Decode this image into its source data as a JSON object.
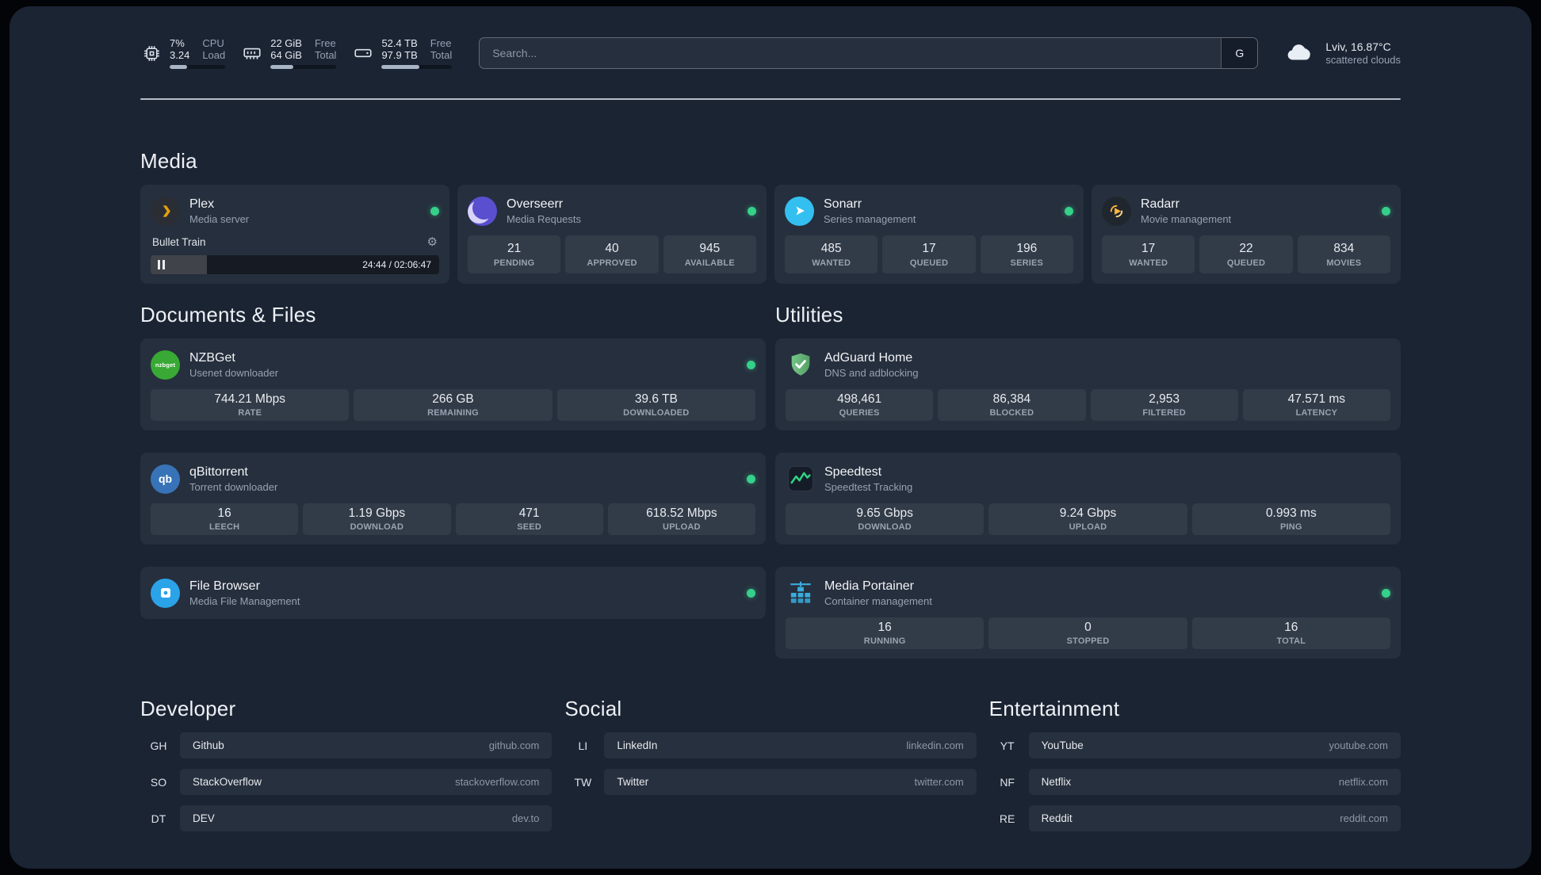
{
  "colors": {
    "background": "#1b2433",
    "card": "rgba(255,255,255,0.05)",
    "tile": "rgba(255,255,255,0.06)",
    "status_online": "#35d08a",
    "plex_gold": "#e5a00d",
    "adguard_green": "#67b47a",
    "speedtest_green": "#2fd180"
  },
  "topbar": {
    "cpu": {
      "icon": "cpu-chip-icon",
      "values": [
        "7%",
        "3.24"
      ],
      "labels": [
        "CPU",
        "Load"
      ],
      "progress_percent": 32
    },
    "memory": {
      "icon": "memory-icon",
      "values": [
        "22 GiB",
        "64 GiB"
      ],
      "labels": [
        "Free",
        "Total"
      ],
      "progress_percent": 35
    },
    "disk": {
      "icon": "disk-icon",
      "values": [
        "52.4 TB",
        "97.9 TB"
      ],
      "labels": [
        "Free",
        "Total"
      ],
      "progress_percent": 54
    },
    "search": {
      "placeholder": "Search...",
      "provider_button": "G"
    },
    "weather": {
      "icon": "cloud-icon",
      "location": "Lviv, 16.87°C",
      "condition": "scattered clouds"
    }
  },
  "sections": {
    "media": {
      "title": "Media",
      "services": {
        "plex": {
          "name": "Plex",
          "subtitle": "Media server",
          "status": "online",
          "player": {
            "track": "Bullet Train",
            "time_display": "24:44 / 02:06:47",
            "progress_percent": 19.5
          }
        },
        "overseerr": {
          "name": "Overseerr",
          "subtitle": "Media Requests",
          "status": "online",
          "stats": [
            {
              "value": "21",
              "label": "PENDING"
            },
            {
              "value": "40",
              "label": "APPROVED"
            },
            {
              "value": "945",
              "label": "AVAILABLE"
            }
          ]
        },
        "sonarr": {
          "name": "Sonarr",
          "subtitle": "Series management",
          "status": "online",
          "stats": [
            {
              "value": "485",
              "label": "WANTED"
            },
            {
              "value": "17",
              "label": "QUEUED"
            },
            {
              "value": "196",
              "label": "SERIES"
            }
          ]
        },
        "radarr": {
          "name": "Radarr",
          "subtitle": "Movie management",
          "status": "online",
          "stats": [
            {
              "value": "17",
              "label": "WANTED"
            },
            {
              "value": "22",
              "label": "QUEUED"
            },
            {
              "value": "834",
              "label": "MOVIES"
            }
          ]
        }
      }
    },
    "documents": {
      "title": "Documents & Files",
      "services": {
        "nzbget": {
          "name": "NZBGet",
          "subtitle": "Usenet downloader",
          "status": "online",
          "icon_text": "nzbget",
          "stats": [
            {
              "value": "744.21 Mbps",
              "label": "RATE"
            },
            {
              "value": "266 GB",
              "label": "REMAINING"
            },
            {
              "value": "39.6 TB",
              "label": "DOWNLOADED"
            }
          ]
        },
        "qbittorrent": {
          "name": "qBittorrent",
          "subtitle": "Torrent downloader",
          "status": "online",
          "icon_text": "qb",
          "stats": [
            {
              "value": "16",
              "label": "LEECH"
            },
            {
              "value": "1.19 Gbps",
              "label": "DOWNLOAD"
            },
            {
              "value": "471",
              "label": "SEED"
            },
            {
              "value": "618.52 Mbps",
              "label": "UPLOAD"
            }
          ]
        },
        "filebrowser": {
          "name": "File Browser",
          "subtitle": "Media File Management",
          "status": "online"
        }
      }
    },
    "utilities": {
      "title": "Utilities",
      "services": {
        "adguard": {
          "name": "AdGuard Home",
          "subtitle": "DNS and adblocking",
          "stats": [
            {
              "value": "498,461",
              "label": "QUERIES"
            },
            {
              "value": "86,384",
              "label": "BLOCKED"
            },
            {
              "value": "2,953",
              "label": "FILTERED"
            },
            {
              "value": "47.571 ms",
              "label": "LATENCY"
            }
          ]
        },
        "speedtest": {
          "name": "Speedtest",
          "subtitle": "Speedtest Tracking",
          "stats": [
            {
              "value": "9.65 Gbps",
              "label": "DOWNLOAD"
            },
            {
              "value": "9.24 Gbps",
              "label": "UPLOAD"
            },
            {
              "value": "0.993 ms",
              "label": "PING"
            }
          ]
        },
        "portainer": {
          "name": "Media Portainer",
          "subtitle": "Container management",
          "status": "online",
          "stats": [
            {
              "value": "16",
              "label": "RUNNING"
            },
            {
              "value": "0",
              "label": "STOPPED"
            },
            {
              "value": "16",
              "label": "TOTAL"
            }
          ]
        }
      }
    }
  },
  "bookmarks": {
    "developer": {
      "title": "Developer",
      "items": [
        {
          "abbr": "GH",
          "name": "Github",
          "url": "github.com"
        },
        {
          "abbr": "SO",
          "name": "StackOverflow",
          "url": "stackoverflow.com"
        },
        {
          "abbr": "DT",
          "name": "DEV",
          "url": "dev.to"
        }
      ]
    },
    "social": {
      "title": "Social",
      "items": [
        {
          "abbr": "LI",
          "name": "LinkedIn",
          "url": "linkedin.com"
        },
        {
          "abbr": "TW",
          "name": "Twitter",
          "url": "twitter.com"
        }
      ]
    },
    "entertainment": {
      "title": "Entertainment",
      "items": [
        {
          "abbr": "YT",
          "name": "YouTube",
          "url": "youtube.com"
        },
        {
          "abbr": "NF",
          "name": "Netflix",
          "url": "netflix.com"
        },
        {
          "abbr": "RE",
          "name": "Reddit",
          "url": "reddit.com"
        }
      ]
    }
  }
}
